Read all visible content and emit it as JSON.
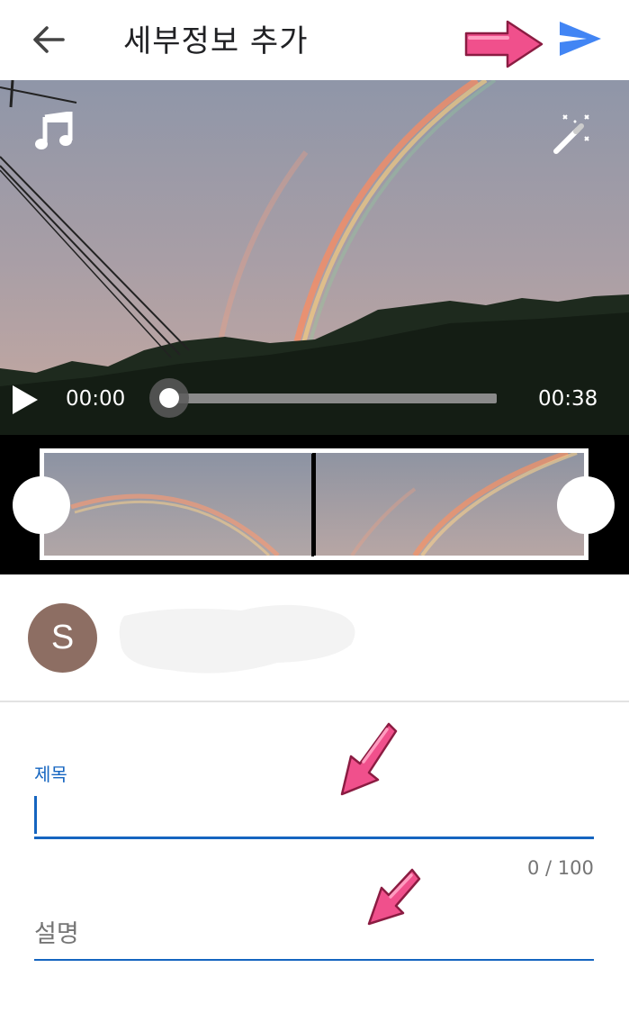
{
  "header": {
    "title": "세부정보 추가",
    "back_icon": "arrow-left-icon",
    "send_icon": "send-icon",
    "accent_color": "#4285f4"
  },
  "player": {
    "current_time": "00:00",
    "duration": "00:38",
    "progress": 0,
    "music_icon": "music-note-icon",
    "effects_icon": "magic-wand-icon",
    "play_icon": "play-icon"
  },
  "channel": {
    "avatar_letter": "S",
    "avatar_color": "#8d6e63"
  },
  "form": {
    "title_label": "제목",
    "title_value": "",
    "title_counter": "0 / 100",
    "description_placeholder": "설명",
    "field_color": "#1565c0"
  },
  "annotations": {
    "arrow_color": "#f0508c"
  }
}
